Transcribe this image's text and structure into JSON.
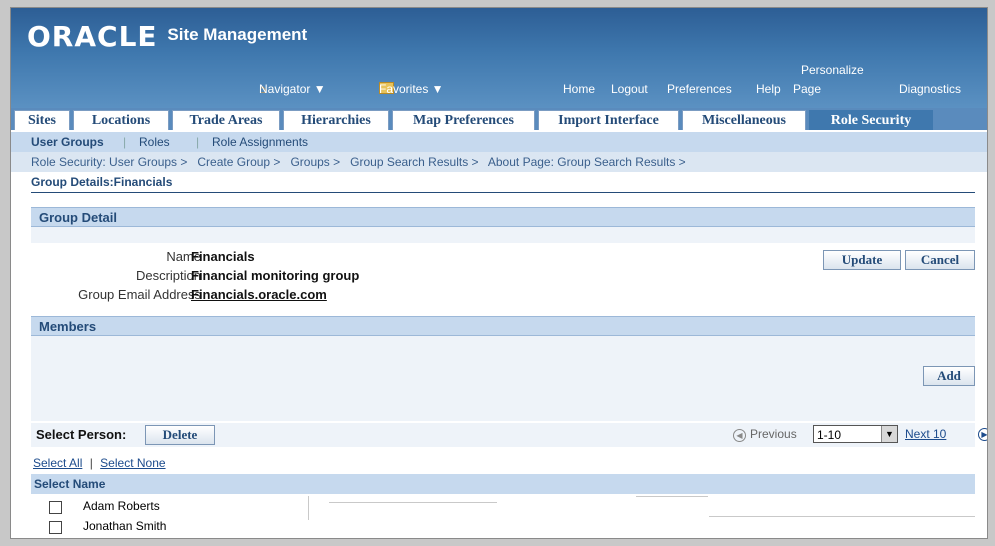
{
  "app": {
    "logo": "ORACLE",
    "name": "Site Management"
  },
  "global_nav": {
    "navigator": "Navigator ▼",
    "favorites": "Favorites ▼",
    "home": "Home",
    "logout": "Logout",
    "preferences": "Preferences",
    "help": "Help",
    "personalize_line1": "Personalize",
    "personalize_line2": "Page",
    "diagnostics": "Diagnostics"
  },
  "tabs": [
    {
      "label": "Sites"
    },
    {
      "label": "Locations"
    },
    {
      "label": "Trade Areas"
    },
    {
      "label": "Hierarchies"
    },
    {
      "label": "Map Preferences"
    },
    {
      "label": "Import Interface"
    },
    {
      "label": "Miscellaneous"
    },
    {
      "label": "Role Security"
    }
  ],
  "subtabs": [
    {
      "label": "User Groups"
    },
    {
      "label": "Roles"
    },
    {
      "label": "Role Assignments"
    }
  ],
  "breadcrumb": "Role Security: User Groups >   Create Group >   Groups >   Group Search Results >   About Page: Group Search Results >",
  "page_title": "Group Details:Financials",
  "group_detail": {
    "section_title": "Group Detail",
    "name_label": "Name",
    "name_value": "Financials",
    "description_label": "Description",
    "description_value": "Financial monitoring group",
    "email_label": "Group Email Address",
    "email_value": "Financials.oracle.com",
    "update_button": "Update",
    "cancel_button": "Cancel"
  },
  "members": {
    "section_title": "Members",
    "add_button": "Add",
    "select_person_label": "Select Person:",
    "delete_button": "Delete",
    "previous": "Previous",
    "range": "1-10",
    "next": "Next 10",
    "select_all": "Select All",
    "select_none": "Select None",
    "column_header": "Select Name",
    "rows": [
      {
        "name": "Adam Roberts"
      },
      {
        "name": "Jonathan Smith"
      }
    ]
  }
}
